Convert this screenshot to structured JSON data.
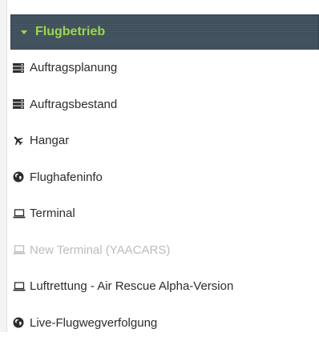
{
  "section": {
    "title": "Flugbetrieb",
    "accent_color": "#9ad94a",
    "header_bg": "#3f4f5c"
  },
  "menu": {
    "items": [
      {
        "label": "Auftragsplanung",
        "icon": "server-icon",
        "disabled": false
      },
      {
        "label": "Auftragsbestand",
        "icon": "server-icon",
        "disabled": false
      },
      {
        "label": "Hangar",
        "icon": "plane-icon",
        "disabled": false
      },
      {
        "label": "Flughafeninfo",
        "icon": "globe-icon",
        "disabled": false
      },
      {
        "label": "Terminal",
        "icon": "laptop-icon",
        "disabled": false
      },
      {
        "label": "New Terminal (YAACARS)",
        "icon": "laptop-icon",
        "disabled": true
      },
      {
        "label": "Luftrettung - Air Rescue Alpha-Version",
        "icon": "laptop-icon",
        "disabled": false
      },
      {
        "label": "Live-Flugwegverfolgung",
        "icon": "globe-icon",
        "disabled": false
      }
    ]
  }
}
